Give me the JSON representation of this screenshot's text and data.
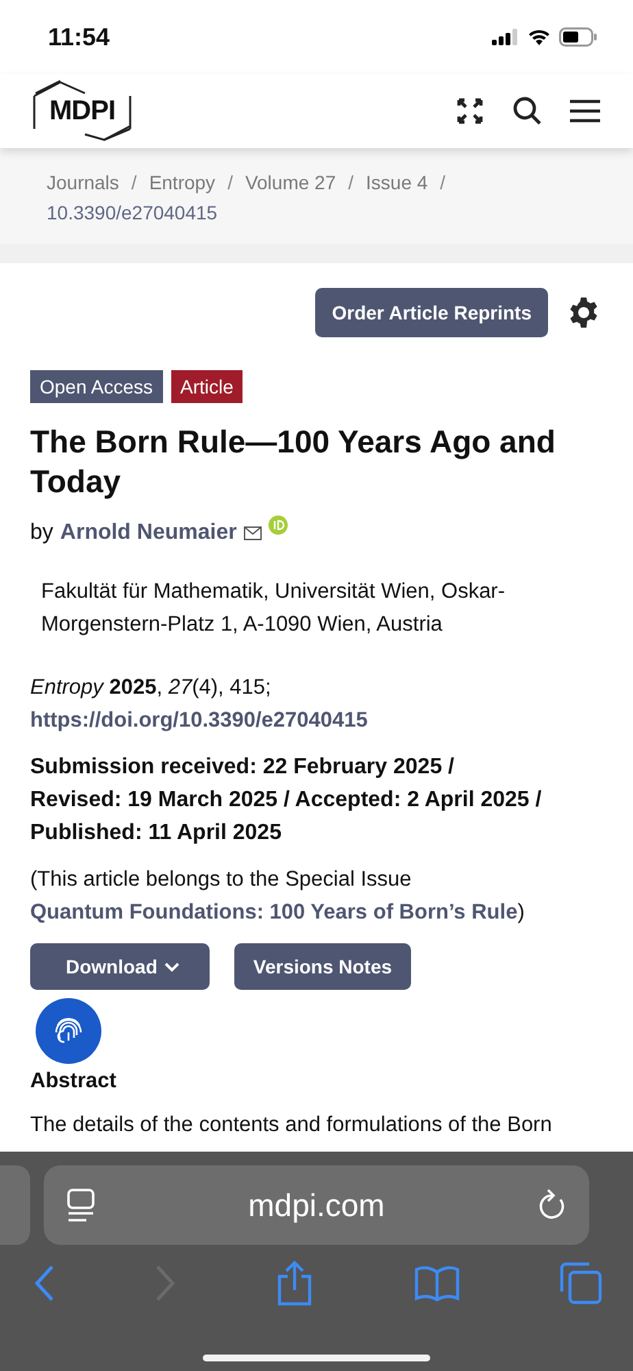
{
  "status_bar": {
    "time": "11:54"
  },
  "header": {
    "logo": "MDPI"
  },
  "breadcrumb": {
    "separator": "/",
    "items": [
      "Journals",
      "Entropy",
      "Volume 27",
      "Issue 4",
      "10.3390/e27040415"
    ]
  },
  "order_button": "Order Article Reprints",
  "tags": [
    {
      "label": "Open Access",
      "color": "#4f5671"
    },
    {
      "label": "Article",
      "color": "#a01c2a"
    }
  ],
  "title": "The Born Rule—100 Years Ago and Today",
  "byline": {
    "prefix": "by",
    "author": "Arnold Neumaier"
  },
  "affiliation": "Fakultät für Mathematik, Universität Wien, Oskar-Morgenstern-Platz 1, A-1090 Wien, Austria",
  "citation": "*Entropy* **2025**, *27*(4), 415;",
  "doi": "https://doi.org/10.3390/e27040415",
  "dates": "Submission received: 22 February 2025 / Revised: 19 March 2025 / Accepted: 2 April 2025 / Published: 11 April 2025",
  "special_issue": {
    "text": "(This article belongs to the Special Issue",
    "link": "Quantum Foundations: 100 Years of Born’s Rule",
    "suffix": ")"
  },
  "buttons": [
    {
      "label": "Download",
      "kind": "dropdown"
    },
    {
      "label": "Versions Notes",
      "kind": "plain"
    }
  ],
  "abstract": {
    "heading": "Abstract",
    "text": "The details of the contents and formulations of the Born"
  },
  "browser": {
    "url": "mdpi.com"
  }
}
